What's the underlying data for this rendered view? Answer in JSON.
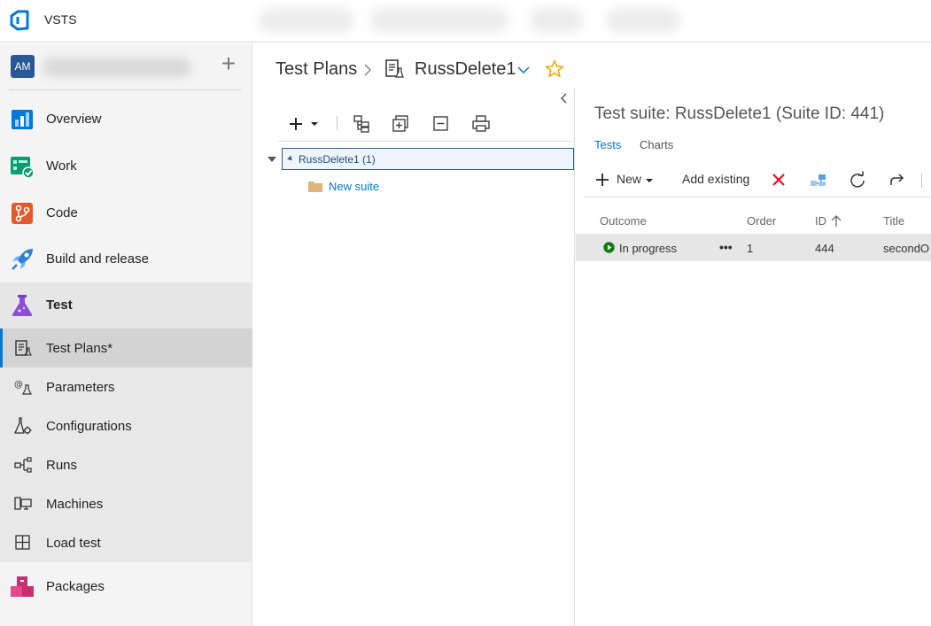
{
  "topbar": {
    "brand": "VSTS"
  },
  "sidebar": {
    "avatar_initials": "AM",
    "nav": [
      {
        "label": "Overview"
      },
      {
        "label": "Work"
      },
      {
        "label": "Code"
      },
      {
        "label": "Build and release"
      },
      {
        "label": "Test"
      },
      {
        "label": "Packages"
      }
    ],
    "test_subnav": [
      {
        "label": "Test Plans*"
      },
      {
        "label": "Parameters"
      },
      {
        "label": "Configurations"
      },
      {
        "label": "Runs"
      },
      {
        "label": "Machines"
      },
      {
        "label": "Load test"
      }
    ]
  },
  "header": {
    "section": "Test Plans",
    "plan_name": "RussDelete1"
  },
  "tree": {
    "root_label": "RussDelete1 (1)",
    "child_label": "New suite"
  },
  "suite": {
    "title": "Test suite: RussDelete1 (Suite ID: 441)",
    "tabs": [
      "Tests",
      "Charts"
    ],
    "toolbar": {
      "new_label": "New",
      "add_existing_label": "Add existing"
    },
    "columns": [
      "Outcome",
      "Order",
      "ID",
      "Title"
    ],
    "rows": [
      {
        "outcome": "In progress",
        "order": "1",
        "id": "444",
        "title": "secondO"
      }
    ]
  },
  "colors": {
    "accent": "#0078d7",
    "outcome_in_progress": "#107c10",
    "delete_red": "#e81123",
    "star": "#f2a900"
  }
}
